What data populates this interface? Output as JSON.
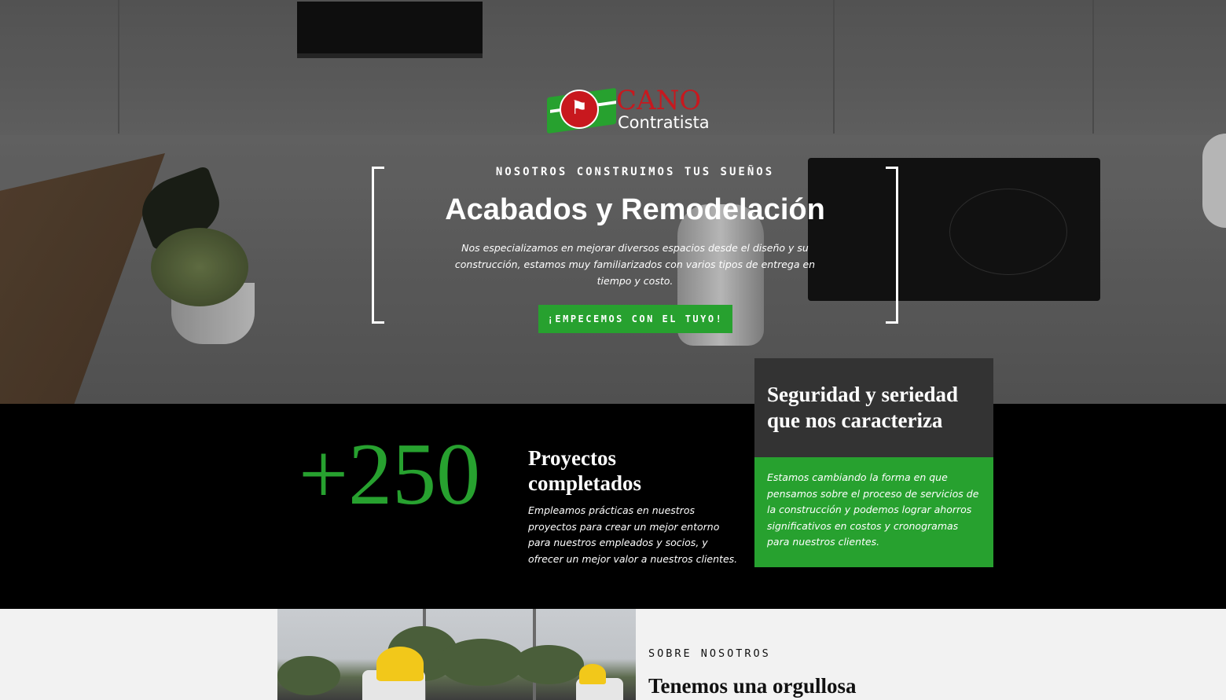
{
  "hero": {
    "logo": {
      "brand_name": "CANO",
      "brand_sub": "Contratista"
    },
    "eyebrow": "NOSOTROS CONSTRUIMOS TUS SUEÑOS",
    "title": "Acabados y Remodelación",
    "description": "Nos especializamos en mejorar diversos espacios desde el diseño y su construcción, estamos muy familiarizados con varios tipos de entrega en tiempo y costo.",
    "cta_label": "¡EMPECEMOS CON EL TUYO!"
  },
  "stats": {
    "number": "+250",
    "title": "Proyectos completados",
    "description": "Empleamos prácticas en nuestros proyectos para crear un mejor entorno para nuestros empleados y socios, y ofrecer un mejor valor a nuestros clientes."
  },
  "card": {
    "title": "Seguridad y seriedad que nos caracteriza",
    "text": "Estamos cambiando la forma en que pensamos sobre el proceso de servicios de la construcción y podemos lograr ahorros significativos en costos y cronogramas para nuestros clientes."
  },
  "about": {
    "eyebrow": "SOBRE NOSOTROS",
    "title": "Tenemos una orgullosa"
  },
  "colors": {
    "accent_green": "#27a12f",
    "brand_red": "#c8181e",
    "band_black": "#000000",
    "card_dark": "#333333"
  },
  "icons": {
    "logo_figure": "worker-figure-icon"
  }
}
